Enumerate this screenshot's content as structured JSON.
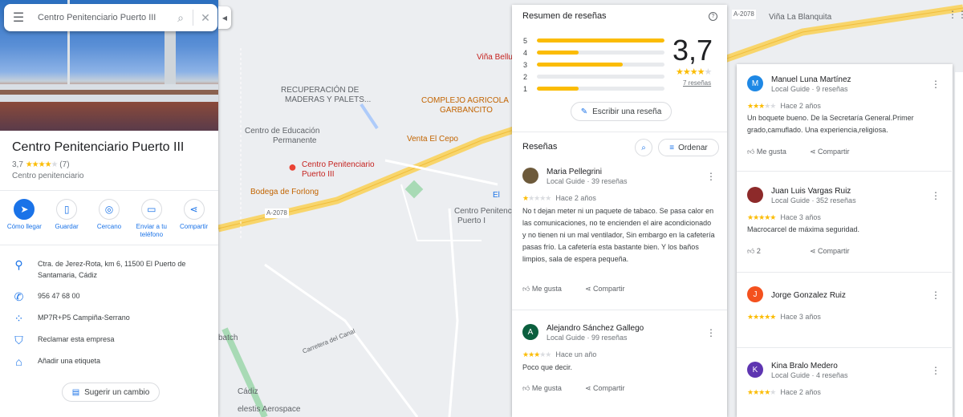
{
  "search": {
    "placeholder": "Centro Penitenciario Puerto III"
  },
  "place": {
    "name": "Centro Penitenciario Puerto III",
    "rating": "3,7",
    "review_count": "(7)",
    "type": "Centro penitenciario"
  },
  "actions": [
    {
      "label": "Cómo llegar",
      "icon": "directions-icon"
    },
    {
      "label": "Guardar",
      "icon": "bookmark-icon"
    },
    {
      "label": "Cercano",
      "icon": "nearby-icon"
    },
    {
      "label": "Enviar a tu teléfono",
      "icon": "send-to-phone-icon"
    },
    {
      "label": "Compartir",
      "icon": "share-icon"
    }
  ],
  "info": {
    "address": "Ctra. de Jerez-Rota, km 6, 11500 El Puerto de Santamaria, Cádiz",
    "phone": "956 47 68 00",
    "plus_code": "MP7R+P5 Campiña-Serrano",
    "claim": "Reclamar esta empresa",
    "label": "Añadir una etiqueta"
  },
  "suggest_label": "Sugerir un cambio",
  "map_labels": {
    "recuperacion": "RECUPERACIÓN DE",
    "recuperacion2": "MADERAS Y PALETS...",
    "educacion": "Centro de Educación",
    "educacion2": "Permanente",
    "pin_title": "Centro Penitenciario",
    "pin_title2": "Puerto III",
    "bodega": "Bodega de Forlong",
    "road1": "A-2078",
    "complejo": "COMPLEJO AGRICOLA",
    "complejo2": "GARBANCITO",
    "venta": "Venta El Cepo",
    "vina": "Viña Belluc",
    "vina2": "Viña La Blanquita",
    "puerto1": "Centro Penitenciario",
    "puerto1b": "Puerto I",
    "carretera": "Carretera del Canal",
    "batch": "batch",
    "cadiz": "Cádiz",
    "aerospace": "elestis Aerospace",
    "road2": "A-2078",
    "el": "El"
  },
  "summary": {
    "title": "Resumen de reseñas",
    "bars": [
      {
        "star": "5",
        "fill": 1.0
      },
      {
        "star": "4",
        "fill": 0.33
      },
      {
        "star": "3",
        "fill": 0.67
      },
      {
        "star": "2",
        "fill": 0.0
      },
      {
        "star": "1",
        "fill": 0.33
      }
    ],
    "score": "3,7",
    "count": "7 reseñas",
    "write": "Escribir una reseña"
  },
  "reviews_header": {
    "title": "Reseñas",
    "sort": "Ordenar"
  },
  "reviews": [
    {
      "name": "Maria Pellegrini",
      "meta": "Local Guide · 39 reseñas",
      "stars": 1,
      "ago": "Hace 2 años",
      "text": "No t dejan meter ni un paquete de tabaco. Se pasa calor en las comunicaciones, no te encienden el aire acondicionado y no tienen ni un mal ventilador, Sin embargo en la cafetería pasas frío. La cafetería esta bastante bien. Y los baños limpios, sala de espera pequeña.",
      "like": "Me gusta",
      "share": "Compartir"
    },
    {
      "name": "Alejandro Sánchez Gallego",
      "meta": "Local Guide · 99 reseñas",
      "initial": "A",
      "color": "#0b5f3e",
      "stars": 3,
      "ago": "Hace un año",
      "text": "Poco que decir.",
      "like": "Me gusta",
      "share": "Compartir"
    }
  ],
  "right_reviews": [
    {
      "name": "Manuel Luna Martínez",
      "meta": "Local Guide · 9 reseñas",
      "initial": "M",
      "color": "#1e88e5",
      "stars": 3,
      "ago": "Hace 2 años",
      "text": "Un boquete bueno. De la Secretaría General.Primer grado,camuflado. Una experiencia,religiosa.",
      "like": "Me gusta",
      "share": "Compartir"
    },
    {
      "name": "Juan Luis Vargas Ruiz",
      "meta": "Local Guide · 352 reseñas",
      "stars": 5,
      "ago": "Hace 3 años",
      "text": "Macrocarcel de máxima seguridad.",
      "like": "2",
      "share": "Compartir"
    },
    {
      "name": "Jorge Gonzalez Ruiz",
      "meta": "",
      "initial": "J",
      "color": "#f4511e",
      "stars": 5,
      "ago": "Hace 3 años"
    },
    {
      "name": "Kina Bralo Medero",
      "meta": "Local Guide · 4 reseñas",
      "initial": "K",
      "color": "#5e35b1",
      "stars": 4,
      "ago": "Hace 2 años"
    }
  ]
}
